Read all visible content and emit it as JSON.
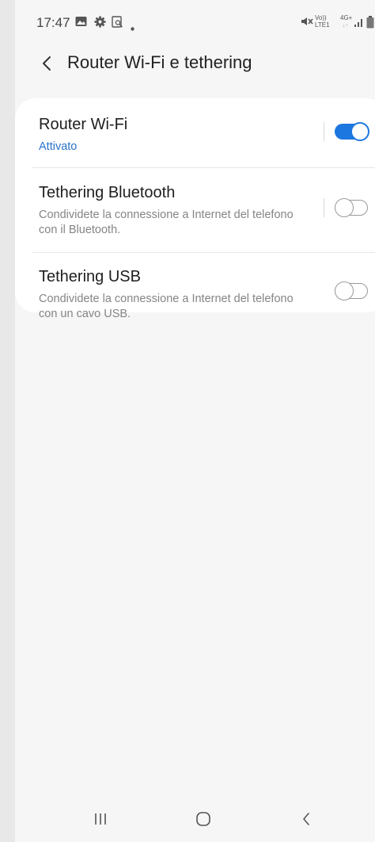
{
  "status_bar": {
    "time": "17:47",
    "left_icons": [
      "image-icon",
      "gear-icon",
      "screenshot-icon",
      "dot-icon"
    ],
    "right_icons": [
      "mute-icon",
      "volte-lte-icon",
      "4g-icon",
      "signal-icon",
      "battery-icon"
    ],
    "volte_line1": "Vo))",
    "volte_line2": "LTE1",
    "net_type": "4G+"
  },
  "header": {
    "title": "Router Wi-Fi e tethering"
  },
  "settings": [
    {
      "title": "Router Wi-Fi",
      "subtitle": "Attivato",
      "enabled": true
    },
    {
      "title": "Tethering Bluetooth",
      "subtitle": "Condividete la connessione a Internet del telefono con il Bluetooth.",
      "enabled": false
    },
    {
      "title": "Tethering USB",
      "subtitle": "Condividete la connessione a Internet del telefono con un cavo USB.",
      "enabled": false
    }
  ],
  "nav_bar": {
    "buttons": [
      "recents-icon",
      "home-icon",
      "back-icon"
    ]
  },
  "colors": {
    "accent": "#1d77e0",
    "subtitle_active": "#2a72c8",
    "background": "#f6f6f6",
    "card": "#ffffff"
  }
}
